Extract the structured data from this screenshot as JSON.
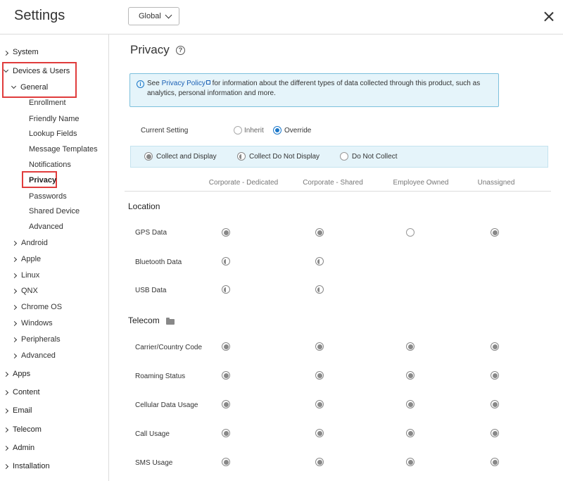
{
  "header": {
    "title": "Settings",
    "scope": "Global"
  },
  "sidebar": {
    "items": [
      {
        "label": "System",
        "caret": "right",
        "level": 0
      },
      {
        "label": "Devices & Users",
        "caret": "down",
        "level": 0
      },
      {
        "label": "General",
        "caret": "down",
        "level": 1
      },
      {
        "label": "Enrollment",
        "level": 2
      },
      {
        "label": "Friendly Name",
        "level": 2
      },
      {
        "label": "Lookup Fields",
        "level": 2
      },
      {
        "label": "Message Templates",
        "level": 2
      },
      {
        "label": "Notifications",
        "level": 2
      },
      {
        "label": "Privacy",
        "level": 2,
        "selected": true
      },
      {
        "label": "Passwords",
        "level": 2
      },
      {
        "label": "Shared Device",
        "level": 2
      },
      {
        "label": "Advanced",
        "level": 2
      },
      {
        "label": "Android",
        "caret": "right",
        "level": 1
      },
      {
        "label": "Apple",
        "caret": "right",
        "level": 1
      },
      {
        "label": "Linux",
        "caret": "right",
        "level": 1
      },
      {
        "label": "QNX",
        "caret": "right",
        "level": 1
      },
      {
        "label": "Chrome OS",
        "caret": "right",
        "level": 1
      },
      {
        "label": "Windows",
        "caret": "right",
        "level": 1
      },
      {
        "label": "Peripherals",
        "caret": "right",
        "level": 1
      },
      {
        "label": "Advanced",
        "caret": "right",
        "level": 1
      },
      {
        "label": "Apps",
        "caret": "right",
        "level": 0
      },
      {
        "label": "Content",
        "caret": "right",
        "level": 0
      },
      {
        "label": "Email",
        "caret": "right",
        "level": 0
      },
      {
        "label": "Telecom",
        "caret": "right",
        "level": 0
      },
      {
        "label": "Admin",
        "caret": "right",
        "level": 0
      },
      {
        "label": "Installation",
        "caret": "right",
        "level": 0
      }
    ],
    "highlight_color": "#e03c3c"
  },
  "main": {
    "title": "Privacy",
    "info": {
      "prefix": "See ",
      "link": "Privacy Policy",
      "text": " for information about the different types of data collected through this product, such as analytics, personal information and more."
    },
    "current_setting": {
      "label": "Current Setting",
      "options": [
        "Inherit",
        "Override"
      ],
      "selected": "Override"
    },
    "legend": {
      "collect_display": "Collect and Display",
      "collect_no_display": "Collect Do Not Display",
      "do_not_collect": "Do Not Collect"
    },
    "columns": [
      "Corporate - Dedicated",
      "Corporate - Shared",
      "Employee Owned",
      "Unassigned"
    ],
    "sections": [
      {
        "title": "Location",
        "rows": [
          {
            "label": "GPS Data",
            "values": [
              "full",
              "full",
              "none",
              "full"
            ]
          },
          {
            "label": "Bluetooth Data",
            "values": [
              "half",
              "half",
              "",
              ""
            ]
          },
          {
            "label": "USB Data",
            "values": [
              "half",
              "half",
              "",
              ""
            ]
          }
        ]
      },
      {
        "title": "Telecom",
        "icon": "folder-icon",
        "rows": [
          {
            "label": "Carrier/Country Code",
            "values": [
              "full",
              "full",
              "full",
              "full"
            ]
          },
          {
            "label": "Roaming Status",
            "values": [
              "full",
              "full",
              "full",
              "full"
            ]
          },
          {
            "label": "Cellular Data Usage",
            "values": [
              "full",
              "full",
              "full",
              "full"
            ]
          },
          {
            "label": "Call Usage",
            "values": [
              "full",
              "full",
              "full",
              "full"
            ]
          },
          {
            "label": "SMS Usage",
            "values": [
              "full",
              "full",
              "full",
              "full"
            ]
          }
        ]
      }
    ],
    "accent_color": "#1a77c9",
    "info_bg": "#e5f4fa"
  }
}
